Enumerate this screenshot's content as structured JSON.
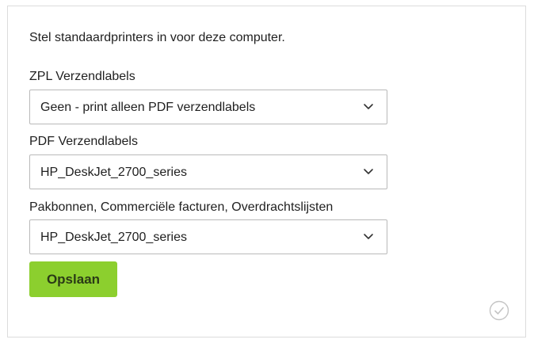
{
  "intro_text": "Stel standaardprinters in voor deze computer.",
  "fields": [
    {
      "label": "ZPL Verzendlabels",
      "value": "Geen - print alleen PDF verzendlabels"
    },
    {
      "label": "PDF Verzendlabels",
      "value": "HP_DeskJet_2700_series"
    },
    {
      "label": "Pakbonnen, Commerciële facturen, Overdrachtslijsten",
      "value": "HP_DeskJet_2700_series"
    }
  ],
  "save_button": {
    "label": "Opslaan"
  },
  "icons": {
    "dropdown": "chevron-down-icon",
    "status": "check-circle-icon"
  },
  "colors": {
    "accent": "#8ccf2e",
    "check": "#c4c4c4"
  }
}
